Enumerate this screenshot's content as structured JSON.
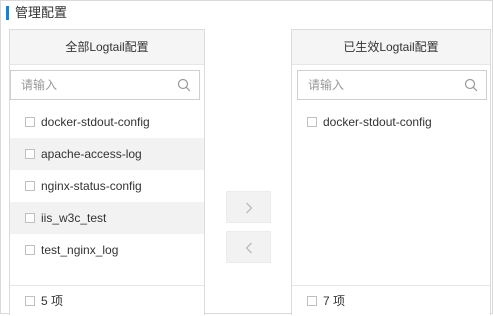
{
  "section": {
    "title": "管理配置",
    "accent_color": "#0b84e6"
  },
  "left_panel": {
    "header": "全部Logtail配置",
    "search_placeholder": "请输入",
    "items": [
      {
        "label": "docker-stdout-config"
      },
      {
        "label": "apache-access-log"
      },
      {
        "label": "nginx-status-config"
      },
      {
        "label": "iis_w3c_test"
      },
      {
        "label": "test_nginx_log"
      }
    ],
    "footer_count": "5 项"
  },
  "right_panel": {
    "header": "已生效Logtail配置",
    "search_placeholder": "请输入",
    "items": [
      {
        "label": "docker-stdout-config"
      }
    ],
    "footer_count": "7 项"
  },
  "transfer": {
    "move_right_icon": "chevron-right-icon",
    "move_left_icon": "chevron-left-icon"
  }
}
